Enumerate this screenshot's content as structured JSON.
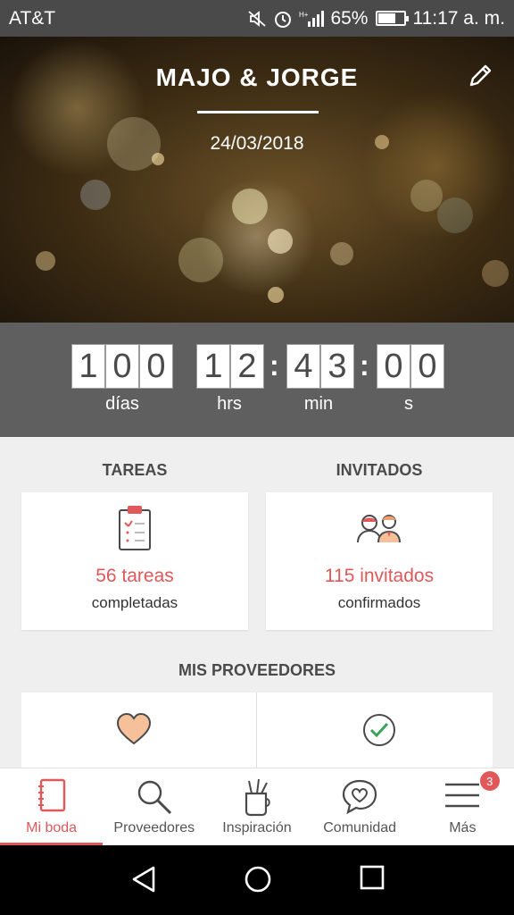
{
  "status_bar": {
    "carrier": "AT&T",
    "battery": "65%",
    "battery_level": 0.65,
    "time": "11:17 a. m.",
    "icons": [
      "mute-icon",
      "alarm-icon",
      "signal-icon",
      "battery-icon"
    ]
  },
  "hero": {
    "title": "MAJO & JORGE",
    "date": "24/03/2018",
    "edit_icon": "pencil-icon"
  },
  "countdown": {
    "days": [
      "1",
      "0",
      "0"
    ],
    "hours": [
      "1",
      "2"
    ],
    "minutes": [
      "4",
      "3"
    ],
    "seconds": [
      "0",
      "0"
    ],
    "separator": ":",
    "labels": {
      "days": "días",
      "hours": "hrs",
      "minutes": "min",
      "seconds": "s"
    }
  },
  "tasks": {
    "heading": "TAREAS",
    "count": "56 tareas",
    "status": "completadas",
    "icon": "clipboard-icon"
  },
  "guests": {
    "heading": "INVITADOS",
    "count": "115 invitados",
    "status": "confirmados",
    "icon": "guests-icon"
  },
  "providers": {
    "heading": "MIS PROVEEDORES",
    "icons": [
      "heart-icon",
      "check-circle-icon"
    ]
  },
  "bottom_nav": {
    "items": [
      {
        "label": "Mi boda",
        "icon": "notebook-icon",
        "active": true
      },
      {
        "label": "Proveedores",
        "icon": "search-icon"
      },
      {
        "label": "Inspiración",
        "icon": "brushes-cup-icon"
      },
      {
        "label": "Comunidad",
        "icon": "chat-heart-icon"
      },
      {
        "label": "Más",
        "icon": "menu-icon",
        "badge": "3"
      }
    ]
  },
  "colors": {
    "accent": "#e0585a",
    "status_bar": "#4a4a4a",
    "countdown_bg": "#5f5f5f",
    "page_bg": "#efefef"
  }
}
